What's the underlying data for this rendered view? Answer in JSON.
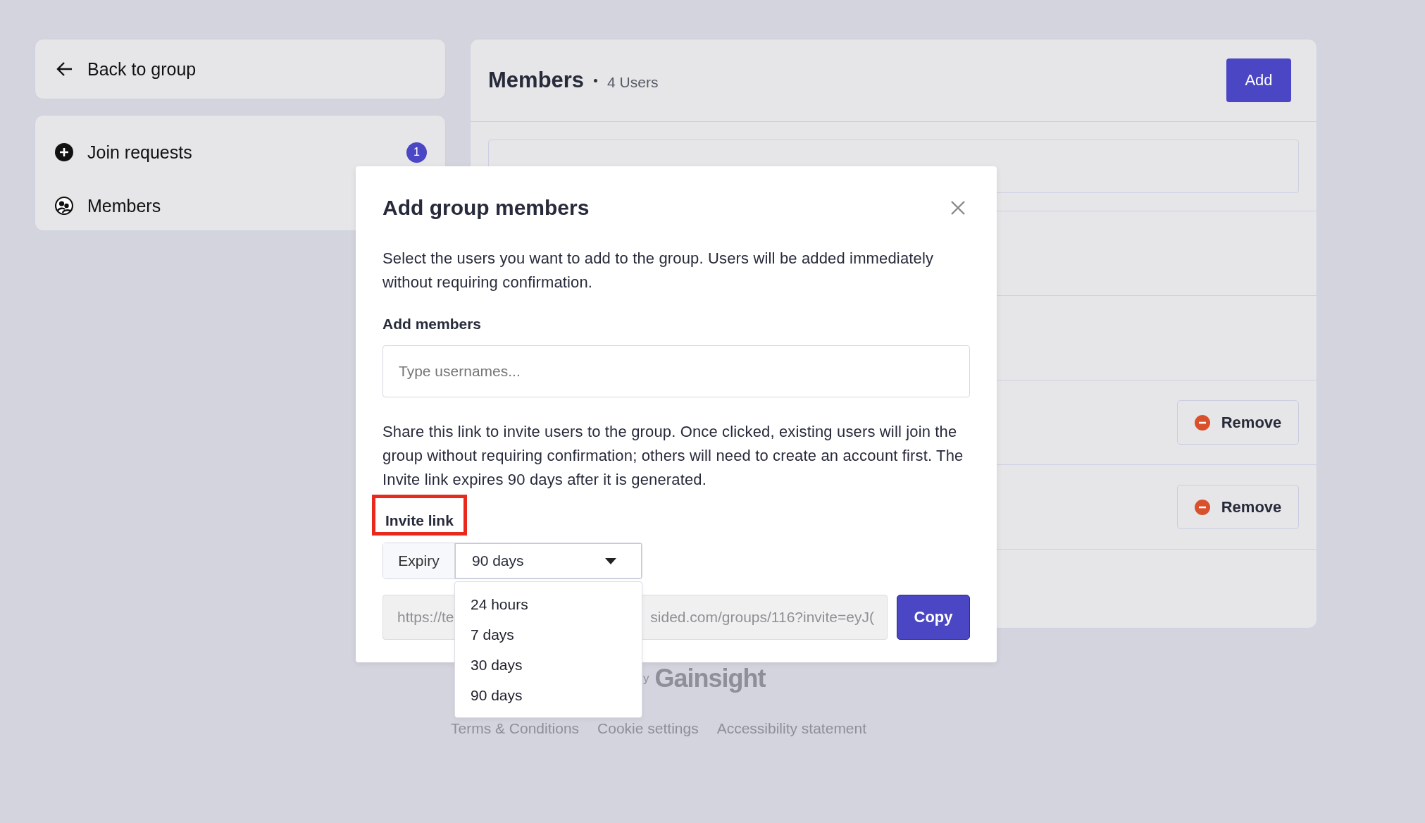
{
  "sidebar": {
    "back_link": "Back to group",
    "nav_items": [
      {
        "label": "Join requests",
        "badge": "1"
      },
      {
        "label": "Members"
      }
    ]
  },
  "members_panel": {
    "title": "Members",
    "count": "4 Users",
    "add_button": "Add",
    "rows": [
      {
        "kind": "plain"
      },
      {
        "kind": "plain"
      },
      {
        "kind": "removable",
        "remove_button": "Remove"
      },
      {
        "kind": "removable",
        "remove_button": "Remove"
      },
      {
        "kind": "plain"
      }
    ]
  },
  "footer": {
    "powered_by": "y",
    "brand": "Gainsight",
    "links": [
      "Terms & Conditions",
      "Cookie settings",
      "Accessibility statement"
    ]
  },
  "modal": {
    "title": "Add group members",
    "description": "Select the users you want to add to the group. Users will be added immediately without requiring confirmation.",
    "add_members_label": "Add members",
    "usernames": {
      "placeholder": "Type usernames..."
    },
    "invite_text": "Share this link to invite users to the group. Once clicked, existing users will join the group without requiring confirmation; others will need to create an account first. The Invite link expires 90 days after it is generated.",
    "invite_label": "Invite link",
    "invite_label_highlighted": true,
    "expiry": {
      "label": "Expiry",
      "value": "90 days",
      "expanded": true,
      "options": [
        "24 hours",
        "7 days",
        "30 days",
        "90 days"
      ]
    },
    "link": {
      "start": "https://te",
      "end": "sided.com/groups/116?invite=eyJ("
    },
    "copy_button": "Copy"
  }
}
